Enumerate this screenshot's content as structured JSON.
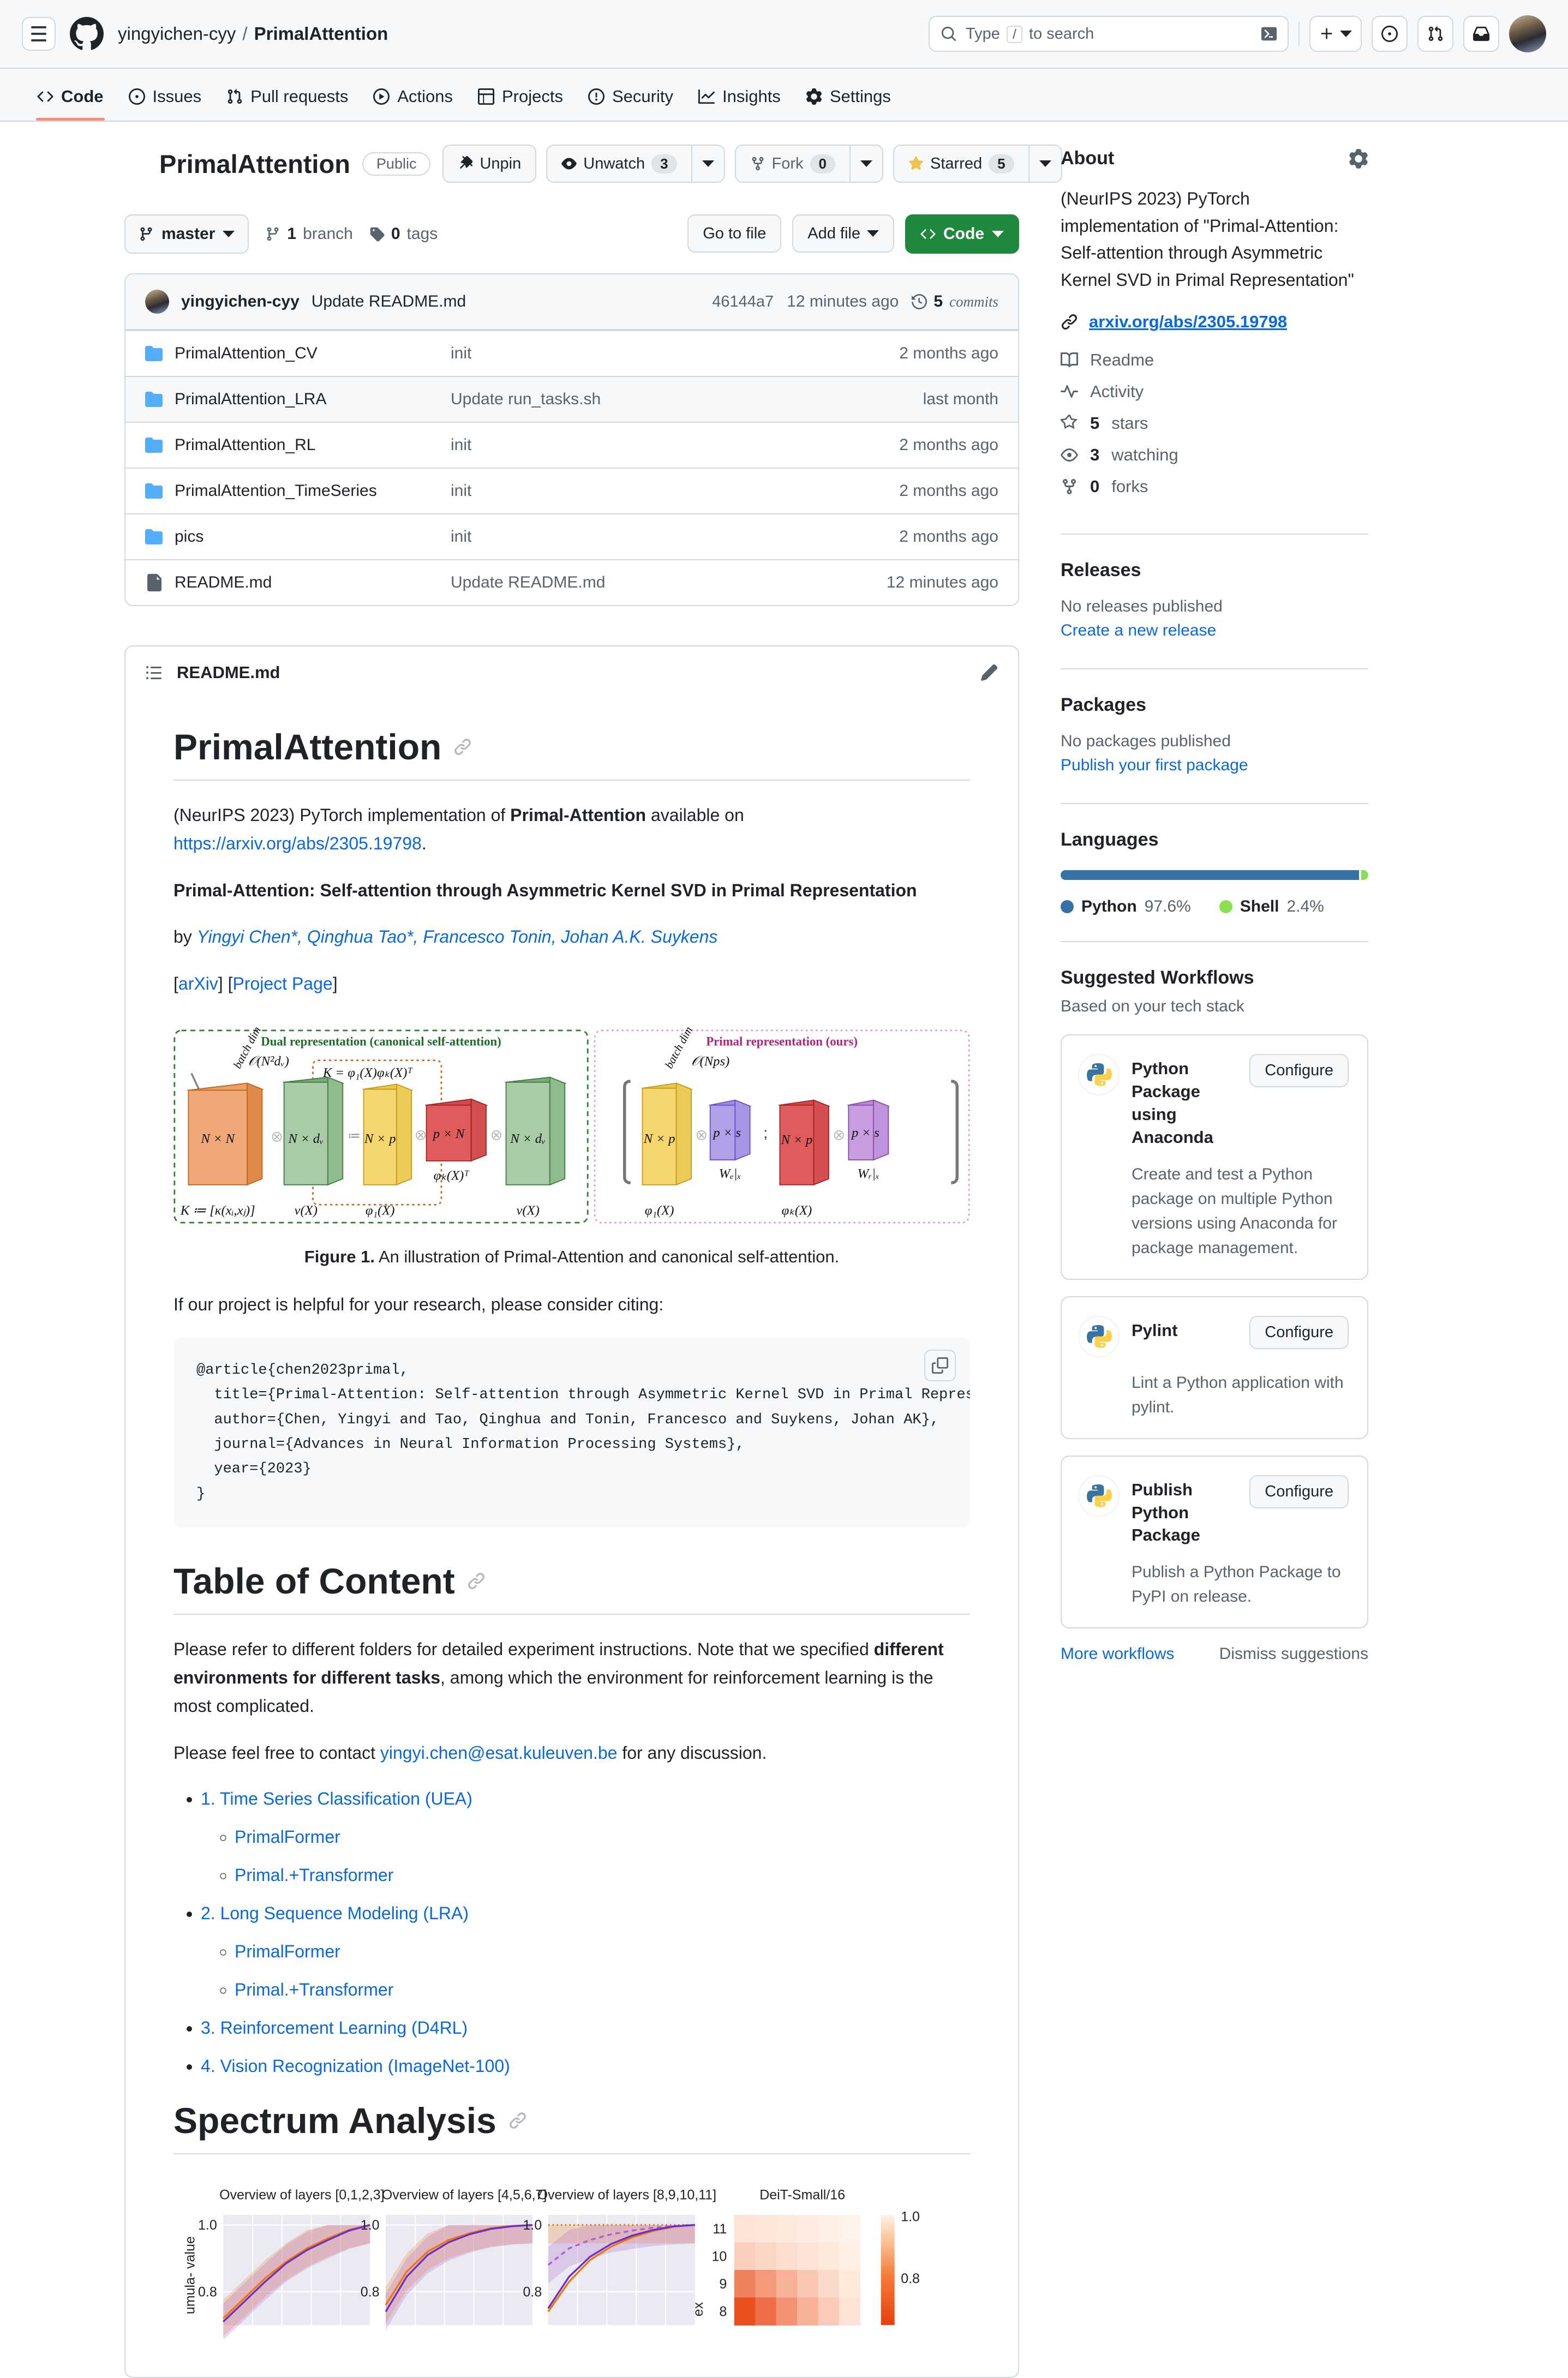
{
  "header": {
    "owner": "yingyichen-cyy",
    "separator": "/",
    "repo": "PrimalAttention",
    "search_placeholder": "Type",
    "search_key": "/",
    "search_placeholder_tail": "to search"
  },
  "nav_tabs": [
    {
      "label": "Code",
      "icon": "code-icon",
      "active": true
    },
    {
      "label": "Issues",
      "icon": "issue-opened-icon",
      "active": false
    },
    {
      "label": "Pull requests",
      "icon": "git-pull-request-icon",
      "active": false
    },
    {
      "label": "Actions",
      "icon": "play-icon",
      "active": false
    },
    {
      "label": "Projects",
      "icon": "table-icon",
      "active": false
    },
    {
      "label": "Security",
      "icon": "shield-icon",
      "active": false
    },
    {
      "label": "Insights",
      "icon": "graph-icon",
      "active": false
    },
    {
      "label": "Settings",
      "icon": "gear-icon",
      "active": false
    }
  ],
  "repo": {
    "name": "PrimalAttention",
    "visibility": "Public",
    "actions": {
      "unpin": "Unpin",
      "unwatch": "Unwatch",
      "watch_count": "3",
      "fork": "Fork",
      "fork_count": "0",
      "starred": "Starred",
      "star_count": "5"
    }
  },
  "toolbar": {
    "branch": "master",
    "branch_count": "1",
    "branch_label": "branch",
    "tag_count": "0",
    "tag_label": "tags",
    "go_to_file": "Go to file",
    "add_file": "Add file",
    "code": "Code"
  },
  "commit_bar": {
    "author": "yingyichen-cyy",
    "message": "Update README.md",
    "sha": "46144a7",
    "time": "12 minutes ago",
    "commits_count": "5",
    "commits_label": "commits"
  },
  "files": [
    {
      "name": "PrimalAttention_CV",
      "type": "folder",
      "message": "init",
      "time": "2 months ago"
    },
    {
      "name": "PrimalAttention_LRA",
      "type": "folder",
      "message": "Update run_tasks.sh",
      "time": "last month"
    },
    {
      "name": "PrimalAttention_RL",
      "type": "folder",
      "message": "init",
      "time": "2 months ago"
    },
    {
      "name": "PrimalAttention_TimeSeries",
      "type": "folder",
      "message": "init",
      "time": "2 months ago"
    },
    {
      "name": "pics",
      "type": "folder",
      "message": "init",
      "time": "2 months ago"
    },
    {
      "name": "README.md",
      "type": "file",
      "message": "Update README.md",
      "time": "12 minutes ago"
    }
  ],
  "readme": {
    "filename": "README.md",
    "h1": "PrimalAttention",
    "intro_pre": "(NeurIPS 2023) PyTorch implementation of ",
    "intro_bold": "Primal-Attention",
    "intro_mid": " available on ",
    "intro_link": "https://arxiv.org/abs/2305.19798",
    "intro_post": ".",
    "paper_title": "Primal-Attention: Self-attention through Asymmetric Kernel SVD in Primal Representation",
    "by_label": "by ",
    "authors": "Yingyi Chen*, Qinghua Tao*, Francesco Tonin, Johan A.K. Suykens",
    "links": {
      "open": "[",
      "arxiv": "arXiv",
      "mid": "] [",
      "project": "Project Page",
      "close": "]"
    },
    "caption_bold": "Figure 1.",
    "caption_rest": " An illustration of Primal-Attention and canonical self-attention.",
    "cite_intro": "If our project is helpful for your research, please consider citing:",
    "bibtex": "@article{chen2023primal,\n  title={Primal-Attention: Self-attention through Asymmetric Kernel SVD in Primal Representation},\n  author={Chen, Yingyi and Tao, Qinghua and Tonin, Francesco and Suykens, Johan AK},\n  journal={Advances in Neural Information Processing Systems},\n  year={2023}\n}",
    "toc_h1": "Table of Content",
    "toc_p1_pre": "Please refer to different folders for detailed experiment instructions. Note that we specified ",
    "toc_p1_bold": "different environments for different tasks",
    "toc_p1_post": ", among which the environment for reinforcement learning is the most complicated.",
    "toc_p2_pre": "Please feel free to contact ",
    "toc_p2_email": "yingyi.chen@esat.kuleuven.be",
    "toc_p2_post": " for any discussion.",
    "toc_items": [
      {
        "label": "1. Time Series Classification (UEA)",
        "children": [
          "PrimalFormer",
          "Primal.+Transformer"
        ]
      },
      {
        "label": "2. Long Sequence Modeling (LRA)",
        "children": [
          "PrimalFormer",
          "Primal.+Transformer"
        ]
      },
      {
        "label": "3. Reinforcement Learning (D4RL)",
        "children": []
      },
      {
        "label": "4. Vision Recognization (ImageNet-100)",
        "children": []
      }
    ],
    "spectrum_h1": "Spectrum Analysis"
  },
  "figure": {
    "dual_title": "Dual representation (canonical self-attention)",
    "primal_title": "Primal representation (ours)",
    "batch_dim": "batch dim",
    "dual_complexity": "O(N²dᵥ)",
    "primal_complexity": "O(Nps)",
    "dual_k_eq": "K = φ₁(X)φₖ(X)ᵀ",
    "blocks": [
      {
        "label": "N × N",
        "under": "K ≔ [κ(xᵢ, xⱼ)]",
        "color": "#f0a878"
      },
      {
        "label": "N × dᵥ",
        "under": "v(X)",
        "color": "#8fbc8f"
      },
      {
        "label": "N × p",
        "under": "φ₁(X)",
        "color": "#f5d76e"
      },
      {
        "label": "p × N",
        "under": "φₖ(X)ᵀ",
        "color": "#e05c5c"
      },
      {
        "label": "N × dᵥ",
        "under": "v(X)",
        "color": "#8fbc8f"
      },
      {
        "label": "N × p",
        "under": "φ₁(X)",
        "color": "#f5d76e"
      },
      {
        "label": "p × s",
        "under": "Wₑ|ₓ",
        "color": "#b0a0e8"
      },
      {
        "label": "N × p",
        "under": "φₖ(X)",
        "color": "#e05c5c"
      },
      {
        "label": "p × s",
        "under": "Wᵣ|ₓ",
        "color": "#c89ee0"
      }
    ]
  },
  "chart_data": [
    {
      "type": "line",
      "title": "Overview of layers [0,1,2,3]",
      "ylabel": "umula- value",
      "yticks": [
        1.0,
        0.8
      ],
      "ylim": [
        0.7,
        1.03
      ],
      "grid": true,
      "series": [
        {
          "name": "orange",
          "color": "#f07800",
          "values": [
            0.72,
            0.78,
            0.84,
            0.89,
            0.93,
            0.96,
            0.985,
            1.0
          ]
        },
        {
          "name": "purple",
          "color": "#6a2fd0",
          "values": [
            0.71,
            0.77,
            0.83,
            0.885,
            0.925,
            0.955,
            0.983,
            1.0
          ]
        }
      ]
    },
    {
      "type": "line",
      "title": "Overview of layers [4,5,6,7]",
      "yticks": [
        1.0,
        0.8
      ],
      "ylim": [
        0.7,
        1.03
      ],
      "grid": true,
      "series": [
        {
          "name": "orange",
          "color": "#f07800",
          "values": [
            0.76,
            0.86,
            0.92,
            0.955,
            0.975,
            0.99,
            0.997,
            1.0
          ]
        },
        {
          "name": "purple",
          "color": "#6a2fd0",
          "values": [
            0.74,
            0.845,
            0.91,
            0.948,
            0.972,
            0.988,
            0.996,
            1.0
          ]
        }
      ]
    },
    {
      "type": "line",
      "title": "Overview of layers [8,9,10,11]",
      "yticks": [
        1.0,
        0.8
      ],
      "ylim": [
        0.7,
        1.03
      ],
      "grid": true,
      "series": [
        {
          "name": "orange-dotted",
          "color": "#f07800",
          "values": [
            1.0,
            1.0,
            1.0,
            1.0,
            1.0,
            1.0,
            1.0,
            1.0
          ]
        },
        {
          "name": "purple-dashed",
          "color": "#b060d0",
          "values": [
            0.88,
            0.93,
            0.955,
            0.972,
            0.983,
            0.992,
            0.997,
            1.0
          ]
        },
        {
          "name": "orange",
          "color": "#f07800",
          "values": [
            0.74,
            0.83,
            0.895,
            0.935,
            0.963,
            0.982,
            0.995,
            1.0
          ]
        },
        {
          "name": "purple",
          "color": "#6a2fd0",
          "values": [
            0.75,
            0.845,
            0.905,
            0.943,
            0.968,
            0.985,
            0.996,
            1.0
          ]
        }
      ]
    },
    {
      "type": "heatmap",
      "title": "DeiT-Small/16",
      "ylabel": "ex",
      "yticks": [
        "11",
        "10",
        "9",
        "8"
      ],
      "colorbar_ticks": [
        "1.0",
        "0.8"
      ],
      "rows": [
        [
          0.95,
          0.96,
          0.97,
          0.98,
          0.99,
          1.0
        ],
        [
          0.88,
          0.91,
          0.93,
          0.95,
          0.97,
          0.99
        ],
        [
          0.62,
          0.7,
          0.78,
          0.85,
          0.92,
          0.97
        ],
        [
          0.45,
          0.56,
          0.68,
          0.78,
          0.87,
          0.95
        ]
      ]
    }
  ],
  "sidebar": {
    "about": {
      "heading": "About",
      "description": "(NeurIPS 2023) PyTorch implementation of \"Primal-Attention: Self-attention through Asymmetric Kernel SVD in Primal Representation\"",
      "website": "arxiv.org/abs/2305.19798",
      "items": [
        {
          "icon": "book-icon",
          "label": "Readme"
        },
        {
          "icon": "pulse-icon",
          "label": "Activity"
        },
        {
          "icon": "star-icon",
          "count": "5",
          "label": "stars"
        },
        {
          "icon": "eye-icon",
          "count": "3",
          "label": "watching"
        },
        {
          "icon": "fork-icon",
          "count": "0",
          "label": "forks"
        }
      ]
    },
    "releases": {
      "heading": "Releases",
      "empty": "No releases published",
      "action": "Create a new release"
    },
    "packages": {
      "heading": "Packages",
      "empty": "No packages published",
      "action": "Publish your first package"
    },
    "languages": {
      "heading": "Languages",
      "items": [
        {
          "name": "Python",
          "pct": "97.6%",
          "value": 97.6,
          "color": "#3572A5"
        },
        {
          "name": "Shell",
          "pct": "2.4%",
          "value": 2.4,
          "color": "#89e051"
        }
      ]
    },
    "workflows": {
      "heading": "Suggested Workflows",
      "subheading": "Based on your tech stack",
      "configure_label": "Configure",
      "cards": [
        {
          "title": "Python Package using Anaconda",
          "desc": "Create and test a Python package on multiple Python versions using Anaconda for package management."
        },
        {
          "title": "Pylint",
          "desc": "Lint a Python application with pylint."
        },
        {
          "title": "Publish Python Package",
          "desc": "Publish a Python Package to PyPI on release."
        }
      ],
      "more": "More workflows",
      "dismiss": "Dismiss suggestions"
    }
  }
}
